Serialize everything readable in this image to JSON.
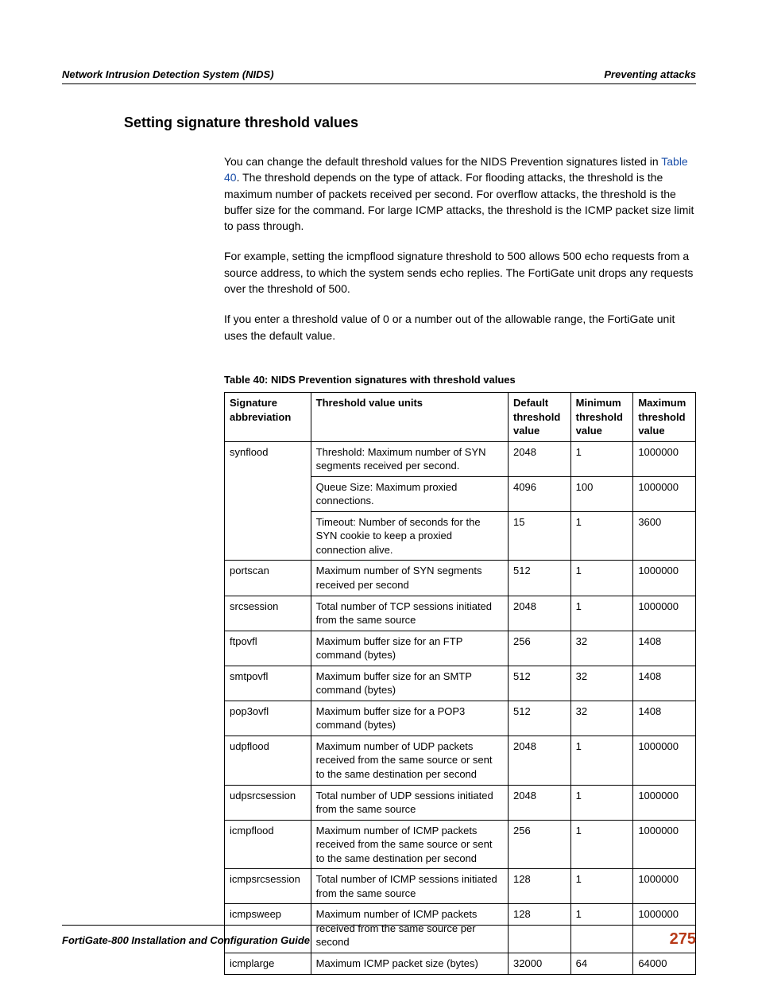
{
  "header": {
    "left": "Network Intrusion Detection System (NIDS)",
    "right": "Preventing attacks"
  },
  "section_title": "Setting signature threshold values",
  "para1_pre": "You can change the default threshold values for the NIDS Prevention signatures listed in ",
  "para1_link": "Table 40",
  "para1_post": ". The threshold depends on the type of attack. For flooding attacks, the threshold is the maximum number of packets received per second. For overflow attacks, the threshold is the buffer size for the command. For large ICMP attacks, the threshold is the ICMP packet size limit to pass through.",
  "para2": "For example, setting the icmpflood signature threshold to 500 allows 500 echo requests from a source address, to which the system sends echo replies. The FortiGate unit drops any requests over the threshold of 500.",
  "para3": "If you enter a threshold value of 0 or a number out of the allowable range, the FortiGate unit uses the default value.",
  "table_caption": "Table 40:  NIDS Prevention signatures with threshold values",
  "table_headers": {
    "sig": "Signature abbreviation",
    "units": "Threshold value units",
    "def": "Default threshold value",
    "min": "Minimum threshold value",
    "max": "Maximum threshold value"
  },
  "rows": [
    {
      "sig": "synflood",
      "units": "Threshold: Maximum number of SYN segments received per second.",
      "def": "2048",
      "min": "1",
      "max": "1000000",
      "rowspan": 3
    },
    {
      "sig": "",
      "units": "Queue Size: Maximum proxied connections.",
      "def": "4096",
      "min": "100",
      "max": "1000000"
    },
    {
      "sig": "",
      "units": "Timeout: Number of seconds for the SYN cookie to keep a proxied connection alive.",
      "def": "15",
      "min": "1",
      "max": "3600"
    },
    {
      "sig": "portscan",
      "units": "Maximum number of SYN segments received per second",
      "def": "512",
      "min": "1",
      "max": "1000000"
    },
    {
      "sig": "srcsession",
      "units": "Total number of TCP sessions initiated from the same source",
      "def": "2048",
      "min": "1",
      "max": "1000000"
    },
    {
      "sig": "ftpovfl",
      "units": "Maximum buffer size for an FTP command (bytes)",
      "def": "256",
      "min": "32",
      "max": "1408"
    },
    {
      "sig": "smtpovfl",
      "units": "Maximum buffer size for an SMTP command (bytes)",
      "def": "512",
      "min": "32",
      "max": "1408"
    },
    {
      "sig": "pop3ovfl",
      "units": "Maximum buffer size for a POP3 command (bytes)",
      "def": "512",
      "min": "32",
      "max": "1408"
    },
    {
      "sig": "udpflood",
      "units": "Maximum number of UDP packets received from the same source or sent to the same destination per second",
      "def": "2048",
      "min": "1",
      "max": "1000000"
    },
    {
      "sig": "udpsrcsession",
      "units": "Total number of UDP sessions initiated from the same source",
      "def": "2048",
      "min": "1",
      "max": "1000000"
    },
    {
      "sig": "icmpflood",
      "units": "Maximum number of ICMP packets received from the same source or sent to the same destination per second",
      "def": "256",
      "min": "1",
      "max": "1000000"
    },
    {
      "sig": "icmpsrcsession",
      "units": "Total number of ICMP sessions initiated from the same source",
      "def": "128",
      "min": "1",
      "max": "1000000"
    },
    {
      "sig": "icmpsweep",
      "units": "Maximum number of ICMP packets received from the same source per second",
      "def": "128",
      "min": "1",
      "max": "1000000"
    },
    {
      "sig": "icmplarge",
      "units": "Maximum ICMP packet size (bytes)",
      "def": "32000",
      "min": "64",
      "max": "64000"
    }
  ],
  "footer": {
    "left": "FortiGate-800 Installation and Configuration Guide",
    "page": "275"
  }
}
